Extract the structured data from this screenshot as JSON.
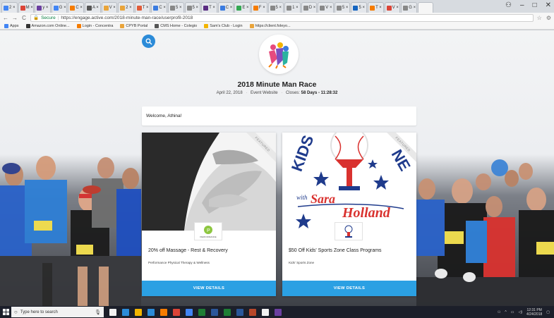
{
  "browser": {
    "tabs": [
      {
        "label": "2 ×",
        "color": "#4285f4"
      },
      {
        "label": "M ×",
        "color": "#db4437"
      },
      {
        "label": "y ×",
        "color": "#6b3fa0"
      },
      {
        "label": "G ×",
        "color": "#4285f4"
      },
      {
        "label": "C ×",
        "color": "#f57c00"
      },
      {
        "label": "A ×",
        "color": "#555555"
      },
      {
        "label": "V ×",
        "color": "#e9a43a"
      },
      {
        "label": "2 ×",
        "color": "#e9a43a"
      },
      {
        "label": "T ×",
        "color": "#e05c3a"
      },
      {
        "label": "C ×",
        "color": "#3a7be0"
      },
      {
        "label": "5 ×",
        "color": "#888888"
      },
      {
        "label": "5 ×",
        "color": "#888888"
      },
      {
        "label": "T ×",
        "color": "#5b2d82"
      },
      {
        "label": "C ×",
        "color": "#3a7be0"
      },
      {
        "label": "E ×",
        "color": "#34a853"
      },
      {
        "label": "F ×",
        "color": "#f57c00"
      },
      {
        "label": "5 ×",
        "color": "#888888"
      },
      {
        "label": "1 ×",
        "color": "#888888"
      },
      {
        "label": "D ×",
        "color": "#888888"
      },
      {
        "label": "V ×",
        "color": "#888888"
      },
      {
        "label": "5 ×",
        "color": "#888888"
      },
      {
        "label": "5 ×",
        "color": "#1565c0"
      },
      {
        "label": "T ×",
        "color": "#f57c00"
      },
      {
        "label": "V ×",
        "color": "#db4437"
      },
      {
        "label": "G ×",
        "color": "#888888"
      },
      {
        "label": "",
        "color": "#f6f6f6"
      }
    ],
    "window_controls": {
      "user": "⚇",
      "minimize": "–",
      "maximize": "□",
      "close": "✕"
    },
    "secure_label": "Secure",
    "url": "https://engage.active.com/2018-minute-man-race/userprofil-2018",
    "bookmarks": [
      {
        "label": "Apps",
        "color": "#4285f4"
      },
      {
        "label": "Amazon.com Online...",
        "color": "#333333"
      },
      {
        "label": "Login - Concentra",
        "color": "#f57c00"
      },
      {
        "label": "CPYB Portal",
        "color": "#e9a43a"
      },
      {
        "label": "CMS Home - Colegio",
        "color": "#555555"
      },
      {
        "label": "Sam's Club - Login",
        "color": "#f2b400"
      },
      {
        "label": "https://client.foleyo...",
        "color": "#e9a43a"
      }
    ]
  },
  "event": {
    "title": "2018 Minute Man Race",
    "date": "April 22, 2018",
    "website_label": "Event Website",
    "closes_prefix": "Closes:",
    "closes_value": "58 Days - 11:28:32"
  },
  "welcome_text": "Welcome, Athina!",
  "cards": [
    {
      "title": "20% off Massage - Rest & Recovery",
      "subtitle": "Performance Physical Therapy & Wellness",
      "badge": "FEATURED",
      "button": "VIEW DETAILS",
      "logo_text": "PERFORMANCE"
    },
    {
      "title": "$50 Off Kids' Sports Zone Class Programs",
      "subtitle": "Kids' Sports Zone",
      "badge": "FEATURED",
      "button": "VIEW DETAILS",
      "image_text_top": "KIDS",
      "image_text_right": "NE",
      "image_text_with": "with",
      "image_text_name1": "Sara",
      "image_text_name2": "Holland"
    }
  ],
  "taskbar": {
    "search_placeholder": "Type here to search",
    "time": "12:31 PM",
    "date": "4/24/2018",
    "apps": [
      "#f2f2f2",
      "#2b8bd8",
      "#f2b400",
      "#2b8bd8",
      "#f57c00",
      "#db4437",
      "#4285f4",
      "#1e7e34",
      "#2b579a",
      "#1e7e34",
      "#2b579a",
      "#b7472a",
      "#f2f2f2",
      "#6b3fa0"
    ]
  }
}
